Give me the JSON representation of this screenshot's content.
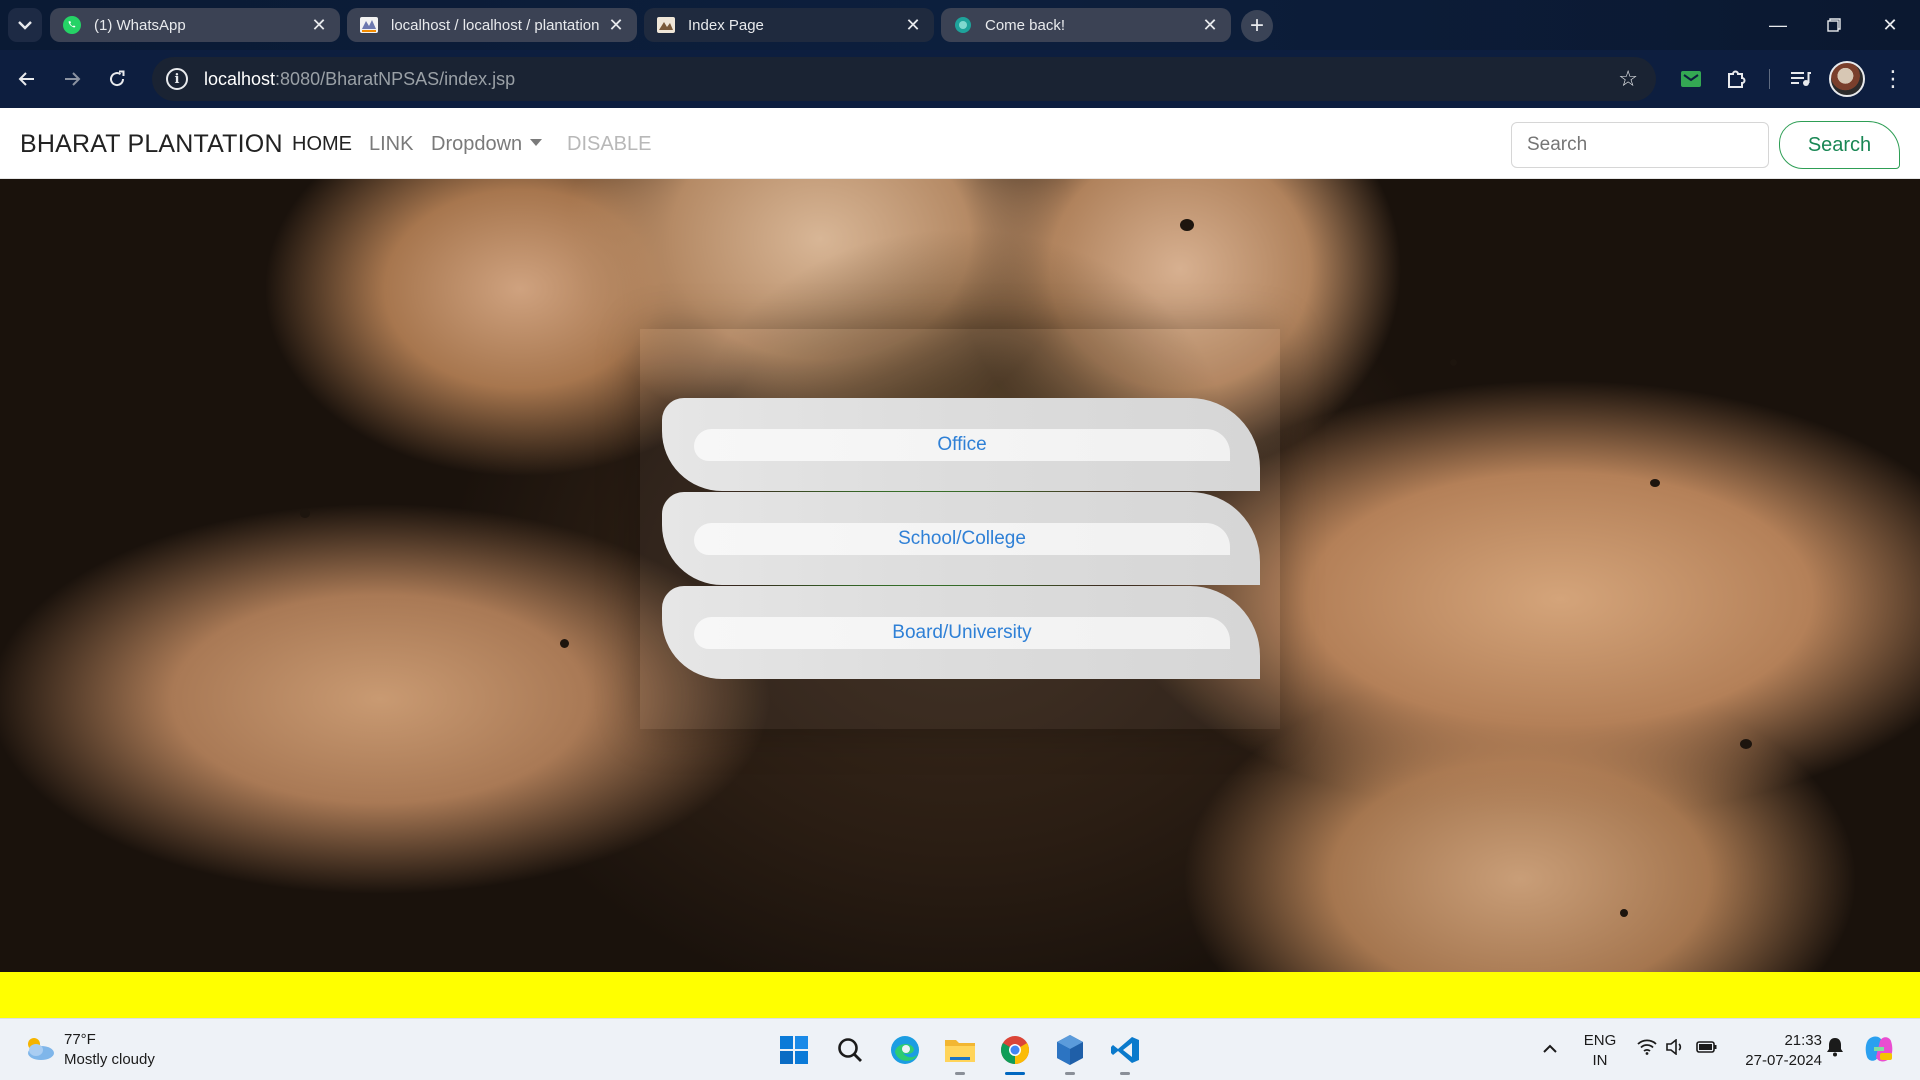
{
  "browser": {
    "tabs": [
      {
        "label": "(1) WhatsApp",
        "icon": "whatsapp-icon",
        "active": false
      },
      {
        "label": "localhost / localhost / plantation",
        "icon": "phpmyadmin-icon",
        "active": false
      },
      {
        "label": "Index Page",
        "icon": "page-icon",
        "active": true
      },
      {
        "label": "Come back!",
        "icon": "globe-icon",
        "active": false
      }
    ],
    "url_host": "localhost",
    "url_path": ":8080/BharatNPSAS/index.jsp"
  },
  "site": {
    "brand": "BHARAT PLANTATION",
    "nav": {
      "home": "HOME",
      "link": "LINK",
      "dropdown": "Dropdown",
      "disable": "DISABLE"
    },
    "search": {
      "placeholder": "Search",
      "button": "Search"
    },
    "options": {
      "office": "Office",
      "school": "School/College",
      "board": "Board/University"
    },
    "colors": {
      "footer": "#ffff00",
      "accent_green": "#198754",
      "link_blue": "#2f80d6"
    }
  },
  "taskbar": {
    "weather_temp": "77°F",
    "weather_desc": "Mostly cloudy",
    "lang_top": "ENG",
    "lang_bottom": "IN",
    "time": "21:33",
    "date": "27-07-2024"
  }
}
